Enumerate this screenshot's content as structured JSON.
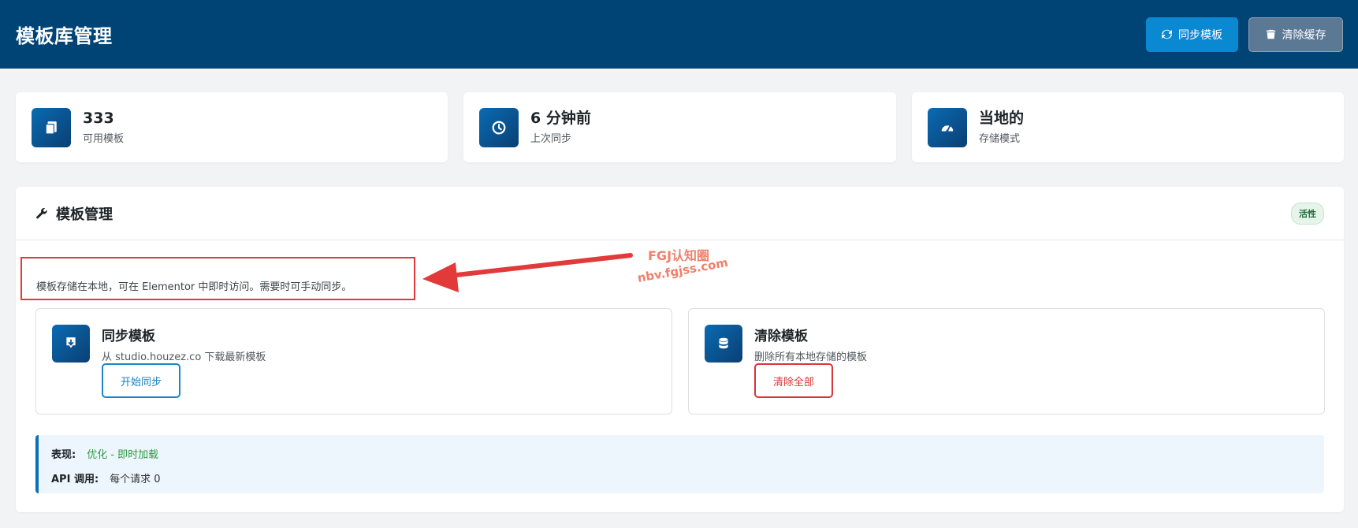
{
  "header": {
    "title": "模板库管理",
    "sync_button": "同步模板",
    "clear_cache_button": "清除缓存"
  },
  "stats": [
    {
      "value": "333",
      "label": "可用模板",
      "icon": "copy-icon"
    },
    {
      "value": "6 分钟前",
      "label": "上次同步",
      "icon": "clock-icon"
    },
    {
      "value": "当地的",
      "label": "存储模式",
      "icon": "gauge-icon"
    }
  ],
  "panel": {
    "title": "模板管理",
    "badge": "活性",
    "description": "模板存储在本地，可在 Elementor 中即时访问。需要时可手动同步。",
    "actions": [
      {
        "title": "同步模板",
        "desc": "从 studio.houzez.co 下载最新模板",
        "button": "开始同步"
      },
      {
        "title": "清除模板",
        "desc": "删除所有本地存储的模板",
        "button": "清除全部"
      }
    ],
    "info": {
      "performance_label": "表现:",
      "performance_value": "优化 - 即时加载",
      "api_label": "API 调用:",
      "api_value": "每个请求 0"
    }
  },
  "watermark": {
    "line1": "FGJ认知圈",
    "line2": "nbv.fgjss.com"
  },
  "colors": {
    "header_bg": "#004475",
    "accent_blue": "#0a89d2",
    "danger_red": "#d63638",
    "success_green": "#2e9a44",
    "annotation_red": "#e23a3a"
  }
}
